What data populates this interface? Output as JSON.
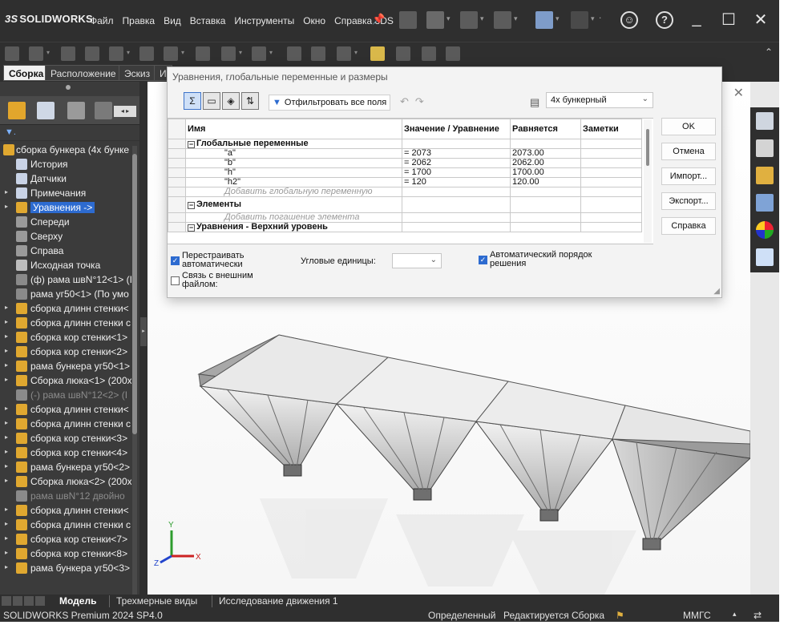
{
  "app": {
    "logo_ds": "3S",
    "logo_name": "SOLIDWORKS",
    "menus": [
      "Файл",
      "Правка",
      "Вид",
      "Вставка",
      "Инструменты",
      "Окно",
      "Справка 3DS"
    ]
  },
  "command_tabs": [
    {
      "label": "Сборка",
      "active": true
    },
    {
      "label": "Расположение",
      "active": false
    },
    {
      "label": "Эскиз",
      "active": false
    },
    {
      "label": "И",
      "active": false
    }
  ],
  "tree": [
    {
      "label": "сборка бункера (4х бунке",
      "icon": "assembly-icon",
      "exp": "",
      "level": 0,
      "state": "normal"
    },
    {
      "label": "История",
      "icon": "history-icon",
      "exp": "",
      "level": 1,
      "state": "normal"
    },
    {
      "label": "Датчики",
      "icon": "sensor-icon",
      "exp": "",
      "level": 1,
      "state": "normal"
    },
    {
      "label": "Примечания",
      "icon": "annotation-icon",
      "exp": "▸",
      "level": 1,
      "state": "normal"
    },
    {
      "label": "Уравнения ->",
      "icon": "equations-icon",
      "exp": "▸",
      "level": 1,
      "state": "selected"
    },
    {
      "label": "Спереди",
      "icon": "plane-icon",
      "exp": "",
      "level": 1,
      "state": "normal"
    },
    {
      "label": "Сверху",
      "icon": "plane-icon",
      "exp": "",
      "level": 1,
      "state": "normal"
    },
    {
      "label": "Справа",
      "icon": "plane-icon",
      "exp": "",
      "level": 1,
      "state": "normal"
    },
    {
      "label": "Исходная точка",
      "icon": "origin-icon",
      "exp": "",
      "level": 1,
      "state": "normal"
    },
    {
      "label": "(ф) рама швN°12<1> (I",
      "icon": "part-icon",
      "exp": "",
      "level": 1,
      "state": "normal"
    },
    {
      "label": "рама уг50<1> (По умо",
      "icon": "part-icon",
      "exp": "",
      "level": 1,
      "state": "normal"
    },
    {
      "label": "сборка длинн стенки<",
      "icon": "subassembly-icon",
      "exp": "▸",
      "level": 1,
      "state": "normal"
    },
    {
      "label": "сборка длинн стенки с",
      "icon": "subassembly-icon",
      "exp": "▸",
      "level": 1,
      "state": "normal"
    },
    {
      "label": "сборка кор стенки<1>",
      "icon": "subassembly-icon",
      "exp": "▸",
      "level": 1,
      "state": "normal"
    },
    {
      "label": "сборка кор стенки<2>",
      "icon": "subassembly-icon",
      "exp": "▸",
      "level": 1,
      "state": "normal"
    },
    {
      "label": "рама бункера уг50<1>",
      "icon": "subassembly-icon",
      "exp": "▸",
      "level": 1,
      "state": "normal"
    },
    {
      "label": "Сборка люка<1> (200х",
      "icon": "subassembly-icon",
      "exp": "▸",
      "level": 1,
      "state": "normal"
    },
    {
      "label": "(-) рама швN°12<2> (I",
      "icon": "part-icon",
      "exp": "",
      "level": 1,
      "state": "dim"
    },
    {
      "label": "сборка длинн стенки<",
      "icon": "subassembly-icon",
      "exp": "▸",
      "level": 1,
      "state": "normal"
    },
    {
      "label": "сборка длинн стенки с",
      "icon": "subassembly-icon",
      "exp": "▸",
      "level": 1,
      "state": "normal"
    },
    {
      "label": "сборка кор стенки<3>",
      "icon": "subassembly-icon",
      "exp": "▸",
      "level": 1,
      "state": "normal"
    },
    {
      "label": "сборка кор стенки<4>",
      "icon": "subassembly-icon",
      "exp": "▸",
      "level": 1,
      "state": "normal"
    },
    {
      "label": "рама бункера уг50<2>",
      "icon": "subassembly-icon",
      "exp": "▸",
      "level": 1,
      "state": "normal"
    },
    {
      "label": "Сборка люка<2> (200х",
      "icon": "subassembly-icon",
      "exp": "▸",
      "level": 1,
      "state": "normal"
    },
    {
      "label": "рама швN°12 двойно",
      "icon": "part-icon",
      "exp": "",
      "level": 1,
      "state": "dim"
    },
    {
      "label": "сборка длинн стенки<",
      "icon": "subassembly-icon",
      "exp": "▸",
      "level": 1,
      "state": "normal"
    },
    {
      "label": "сборка длинн стенки с",
      "icon": "subassembly-icon",
      "exp": "▸",
      "level": 1,
      "state": "normal"
    },
    {
      "label": "сборка кор стенки<7>",
      "icon": "subassembly-icon",
      "exp": "▸",
      "level": 1,
      "state": "normal"
    },
    {
      "label": "сборка кор стенки<8>",
      "icon": "subassembly-icon",
      "exp": "▸",
      "level": 1,
      "state": "normal"
    },
    {
      "label": "рама бункера уг50<3>",
      "icon": "subassembly-icon",
      "exp": "▸",
      "level": 1,
      "state": "normal"
    }
  ],
  "dialog": {
    "title": "Уравнения, глобальные переменные и размеры",
    "filter_label": "Отфильтровать все поля",
    "config": "4х бункерный",
    "columns": [
      "Имя",
      "Значение / Уравнение",
      "Равняется",
      "Заметки"
    ],
    "sections": {
      "globals_title": "Глобальные переменные",
      "globals_add": "Добавить глобальную переменную",
      "features_title": "Элементы",
      "features_add": "Добавить погашение элемента",
      "partial_row": "Уравнения - Верхний уровень"
    },
    "globals": [
      {
        "name": "\"a\"",
        "equation": "= 2073",
        "value": "2073.00",
        "note": ""
      },
      {
        "name": "\"b\"",
        "equation": "= 2062",
        "value": "2062.00",
        "note": ""
      },
      {
        "name": "\"h\"",
        "equation": "= 1700",
        "value": "1700.00",
        "note": ""
      },
      {
        "name": "\"h2\"",
        "equation": "= 120",
        "value": "120.00",
        "note": ""
      }
    ],
    "buttons": {
      "ok": "OK",
      "cancel": "Отмена",
      "import": "Импорт...",
      "export": "Экспорт...",
      "help": "Справка"
    },
    "options": {
      "rebuild_label_1": "Перестраивать",
      "rebuild_label_2": "автоматически",
      "rebuild_checked": true,
      "link_label_1": "Связь с внешним",
      "link_label_2": "файлом:",
      "link_checked": false,
      "angle_units_label": "Угловые единицы:",
      "angle_units_value": "",
      "auto_order_label_1": "Автоматический порядок",
      "auto_order_label_2": "решения",
      "auto_order_checked": true
    }
  },
  "triad": {
    "x": "X",
    "y": "Y",
    "z": "Z"
  },
  "bottom_tabs": [
    {
      "label": "Модель",
      "active": true
    },
    {
      "label": "Трехмерные виды",
      "active": false
    },
    {
      "label": "Исследование движения 1",
      "active": false
    }
  ],
  "status": {
    "product": "SOLIDWORKS Premium 2024 SP4.0",
    "defined": "Определенный",
    "editing": "Редактируется Сборка",
    "units": "ММГС"
  },
  "colors": {
    "chrome": "#2f2f2f",
    "panel": "#3b3b3b",
    "selection": "#2d6bd0",
    "dialog_bg": "#f3f3f3",
    "subassembly_icon": "#e0a830",
    "part_icon": "#8a8a8a"
  }
}
